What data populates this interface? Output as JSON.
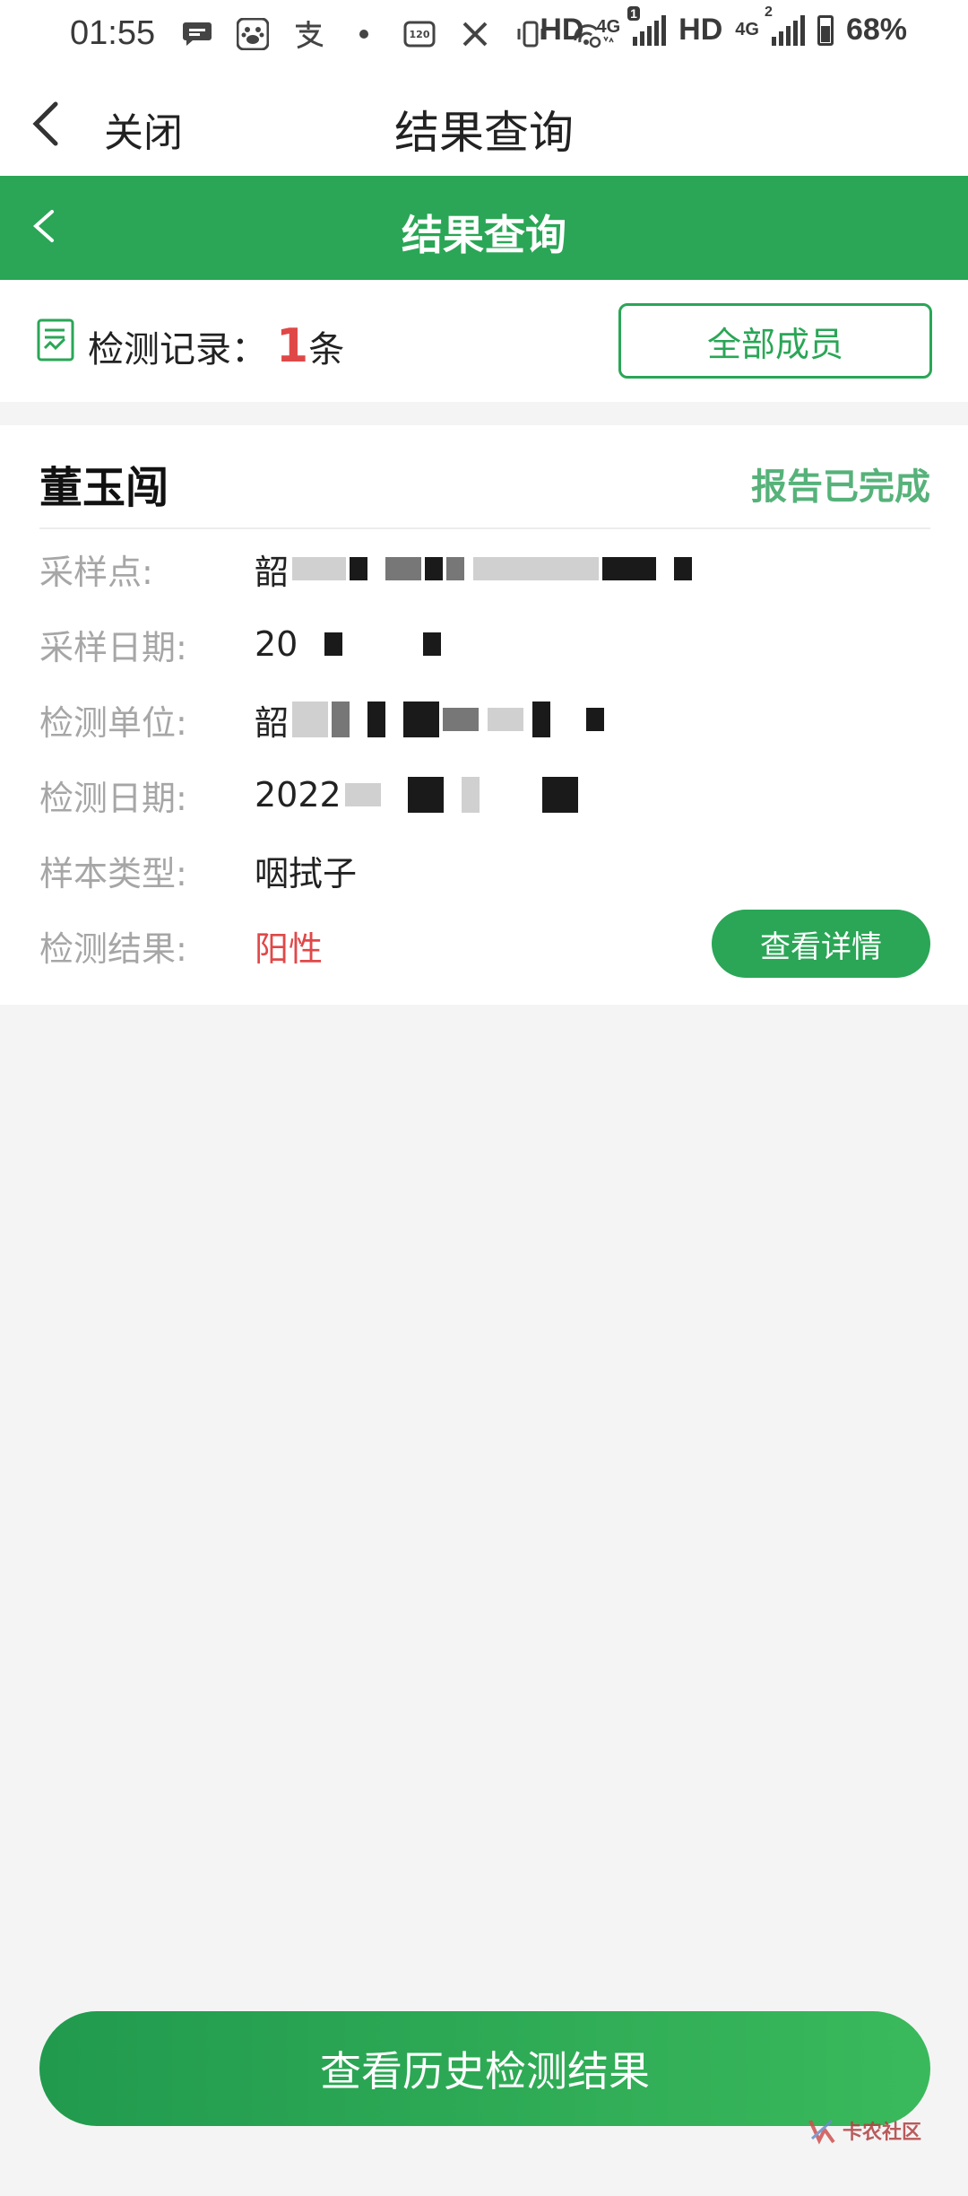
{
  "status_bar": {
    "time": "01:55",
    "right_text": "HD",
    "net1": "4G",
    "net2": "HD",
    "net3": "4G",
    "sim_badge1": "1",
    "sim_badge2": "2",
    "battery": "68%",
    "icons": [
      "message-icon",
      "baidu-paw-icon",
      "alipay-icon",
      "dot-icon",
      "refresh-rate-120-icon",
      "x-icon",
      "vibrate-icon",
      "hotspot-icon"
    ]
  },
  "topnav": {
    "close_label": "关闭",
    "title": "结果查询"
  },
  "header": {
    "title": "结果查询"
  },
  "records": {
    "label": "检测记录：",
    "count": "1",
    "unit": "条",
    "all_members_label": "全部成员"
  },
  "card": {
    "name": "董玉闯",
    "status": "报告已完成",
    "rows": [
      {
        "label": "采样点:",
        "value": "韶"
      },
      {
        "label": "采样日期:",
        "value": "20"
      },
      {
        "label": "检测单位:",
        "value": "韶"
      },
      {
        "label": "检测日期:",
        "value": "2022"
      },
      {
        "label": "样本类型:",
        "value": "咽拭子"
      },
      {
        "label": "检测结果:",
        "value": "阳性"
      }
    ],
    "detail_button": "查看详情"
  },
  "bottom": {
    "history_button": "查看历史检测结果"
  },
  "watermark": {
    "text": "卡农社区"
  },
  "colors": {
    "brand_green": "#2aa656",
    "positive_red": "#e04848",
    "status_green": "#56b27a"
  }
}
